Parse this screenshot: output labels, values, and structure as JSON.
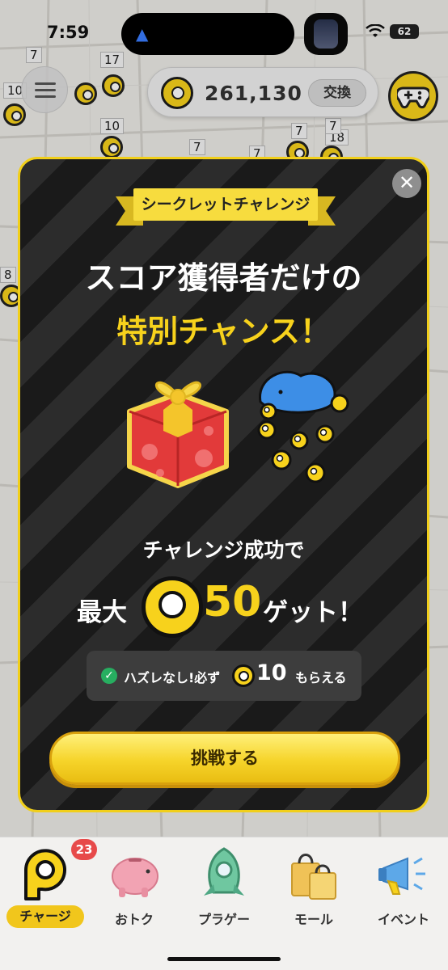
{
  "status_bar": {
    "time": "7:59",
    "battery": "62"
  },
  "header": {
    "coin_count": "261,130",
    "exchange_label": "交換"
  },
  "map": {
    "pin_labels": [
      "7",
      "17",
      "10",
      "10",
      "7",
      "7",
      "7",
      "18",
      "7",
      "8"
    ]
  },
  "modal": {
    "ribbon_label": "シークレットチャレンジ",
    "headline_line1": "スコア獲得者だけの",
    "headline_line2": "特別チャンス！",
    "sub_text": "チャレンジ成功で",
    "reward_prefix": "最大",
    "reward_amount": "50",
    "reward_suffix": "ゲット！",
    "guarantee_text": "ハズレなし!必ず",
    "guarantee_amount": "10",
    "guarantee_suffix": "もらえる",
    "challenge_button": "挑戦する",
    "close_glyph": "✕"
  },
  "bottom_nav": {
    "items": [
      {
        "label": "チャージ",
        "active": true,
        "badge": "23"
      },
      {
        "label": "おトク"
      },
      {
        "label": "プラゲー"
      },
      {
        "label": "モール"
      },
      {
        "label": "イベント"
      }
    ]
  },
  "colors": {
    "accent_yellow": "#f7d21c",
    "badge_red": "#e74a4a",
    "modal_border": "#f1cf1a"
  }
}
